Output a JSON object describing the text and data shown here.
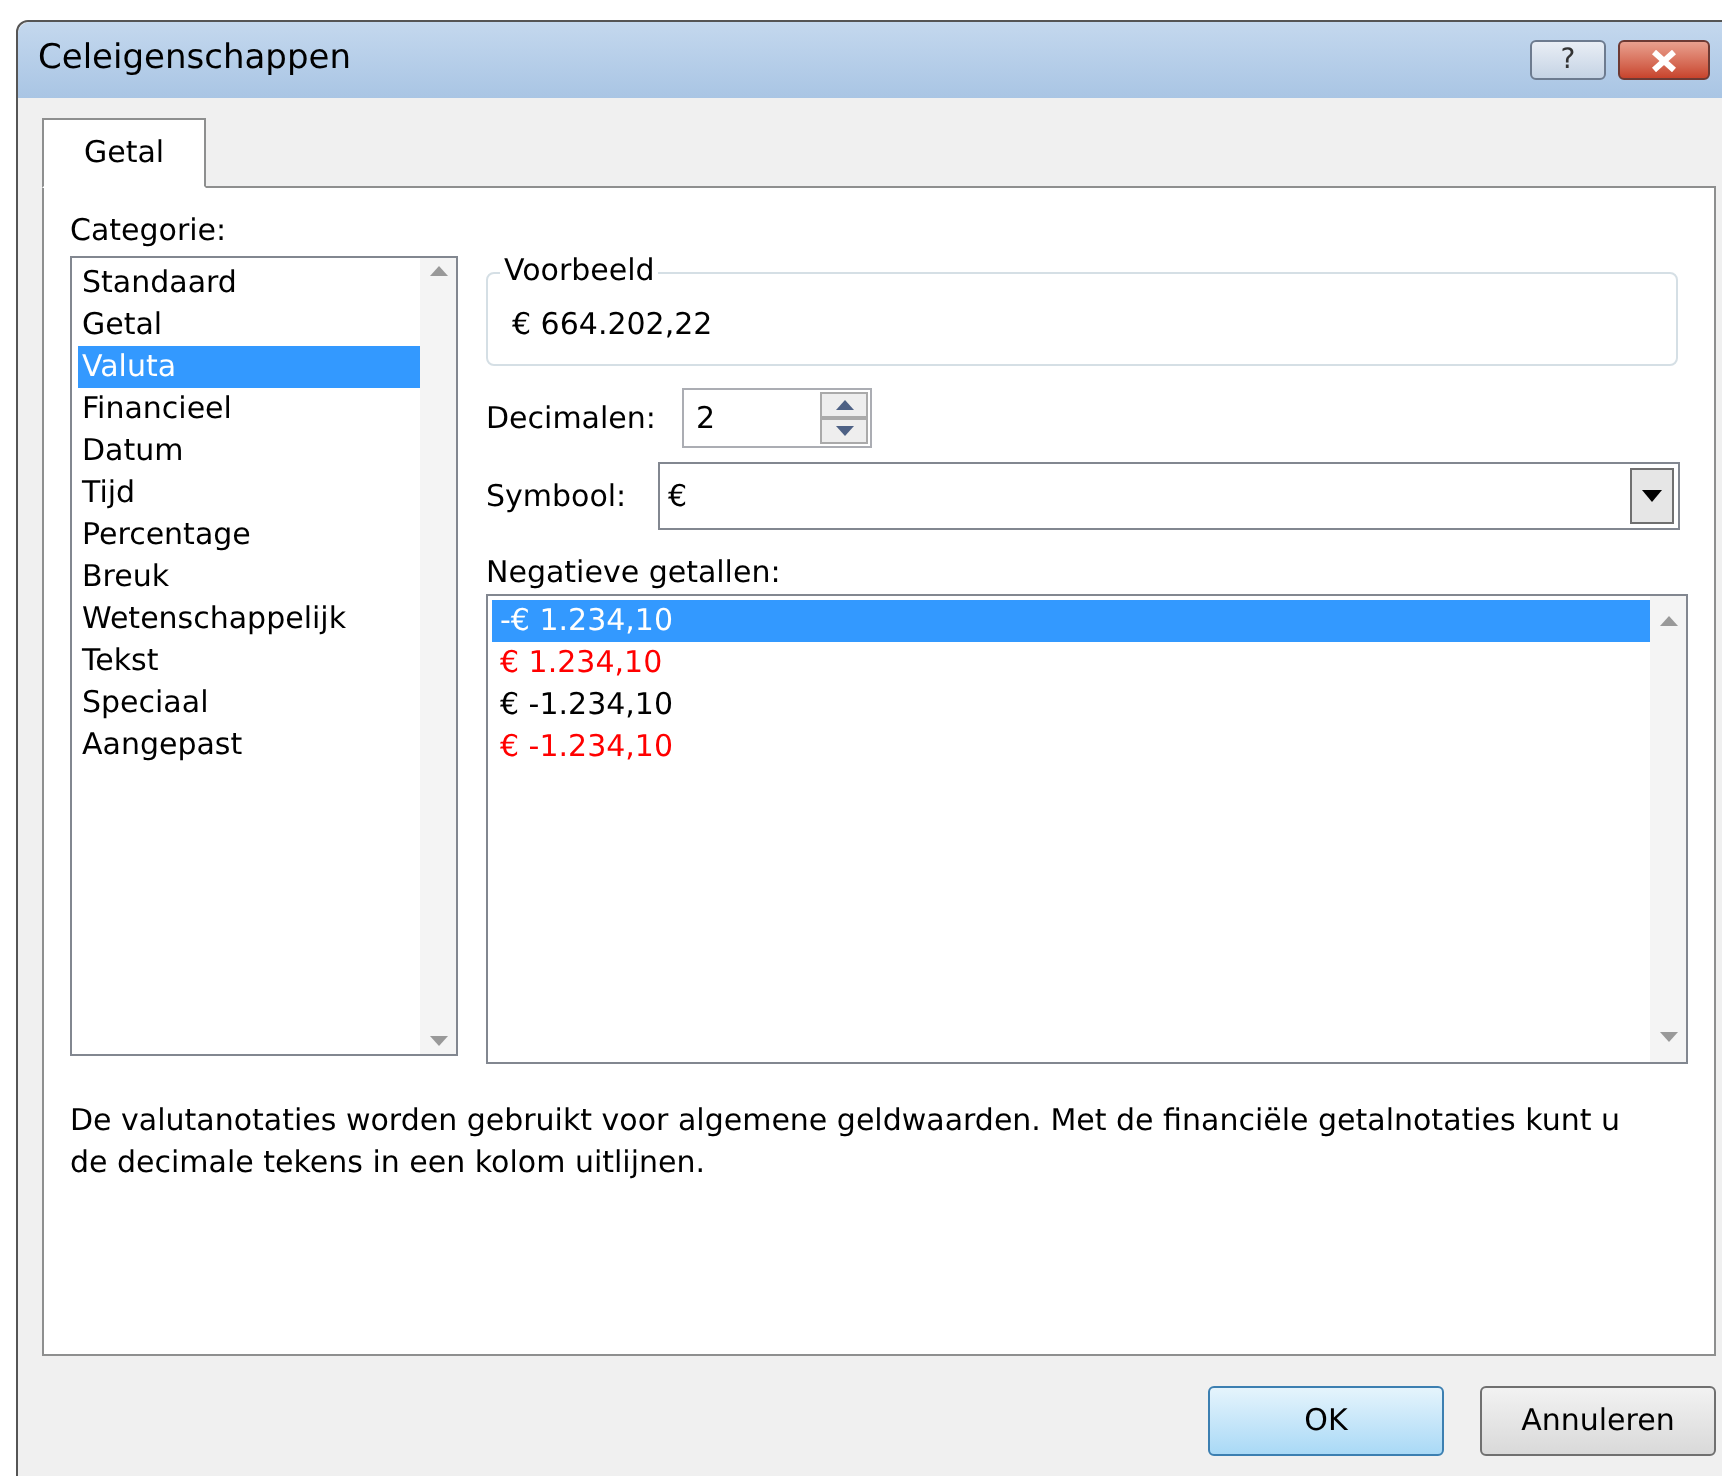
{
  "window": {
    "title": "Celeigenschappen",
    "buttons": [
      {
        "kind": "help",
        "label": "?"
      },
      {
        "kind": "close"
      }
    ]
  },
  "tabs": [
    {
      "label": "Getal",
      "selected": true
    }
  ],
  "category": {
    "label": "Categorie:",
    "items": [
      {
        "label": "Standaard",
        "selected": false
      },
      {
        "label": "Getal",
        "selected": false
      },
      {
        "label": "Valuta",
        "selected": true
      },
      {
        "label": "Financieel",
        "selected": false
      },
      {
        "label": "Datum",
        "selected": false
      },
      {
        "label": "Tijd",
        "selected": false
      },
      {
        "label": "Percentage",
        "selected": false
      },
      {
        "label": "Breuk",
        "selected": false
      },
      {
        "label": "Wetenschappelijk",
        "selected": false
      },
      {
        "label": "Tekst",
        "selected": false
      },
      {
        "label": "Speciaal",
        "selected": false
      },
      {
        "label": "Aangepast",
        "selected": false
      }
    ]
  },
  "preview": {
    "label": "Voorbeeld",
    "value": "€ 664.202,22"
  },
  "decimals": {
    "label": "Decimalen:",
    "value": "2"
  },
  "symbol": {
    "label": "Symbool:",
    "value": "€"
  },
  "negative_numbers": {
    "label": "Negatieve getallen:",
    "items": [
      {
        "label": "-€ 1.234,10",
        "selected": true
      },
      {
        "label": "€ 1.234,10",
        "color": "#ff0000",
        "selected": false
      },
      {
        "label": "€ -1.234,10",
        "color": "#000000",
        "selected": false
      },
      {
        "label": "€ -1.234,10",
        "color": "#ff0000",
        "selected": false
      }
    ]
  },
  "description": "De valutanotaties worden gebruikt voor algemene geldwaarden. Met de financiële getalnotaties kunt u de decimale tekens in een kolom uitlijnen.",
  "buttons": [
    {
      "label": "OK",
      "default": true
    },
    {
      "label": "Annuleren",
      "default": false
    }
  ]
}
